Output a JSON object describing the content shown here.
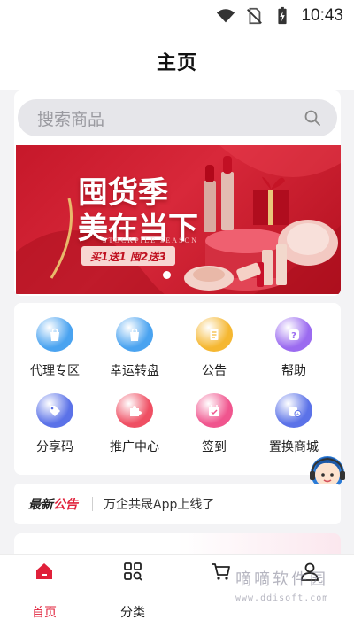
{
  "status_bar": {
    "time": "10:43"
  },
  "header": {
    "title": "主页"
  },
  "search": {
    "placeholder": "搜索商品"
  },
  "banner": {
    "title_line1": "囤货季",
    "title_line2": "美在当下",
    "subtitle": "STOCKPILE SEASON",
    "promo": "买1送1 囤2送3",
    "slide_count": 1,
    "active_slide": 1
  },
  "grid": {
    "items": [
      {
        "label": "代理专区",
        "icon": "shopping-bag-icon",
        "color": "#4aa3f0"
      },
      {
        "label": "幸运转盘",
        "icon": "shopping-bag-icon",
        "color": "#4aa3f0"
      },
      {
        "label": "公告",
        "icon": "document-icon",
        "color": "#f5b731"
      },
      {
        "label": "帮助",
        "icon": "question-icon",
        "color": "#9b6bf0"
      },
      {
        "label": "分享码",
        "icon": "tag-icon",
        "color": "#5b72e8"
      },
      {
        "label": "推广中心",
        "icon": "puzzle-icon",
        "color": "#ef4f63"
      },
      {
        "label": "签到",
        "icon": "calendar-check-icon",
        "color": "#f0558e"
      },
      {
        "label": "置换商城",
        "icon": "coins-icon",
        "color": "#5b72e8"
      }
    ]
  },
  "notice": {
    "label_prefix": "最新",
    "label_accent": "公告",
    "text": "万企共晟App上线了"
  },
  "bottom_nav": {
    "items": [
      {
        "label": "首页",
        "icon": "home-icon",
        "active": true
      },
      {
        "label": "分类",
        "icon": "category-icon",
        "active": false
      },
      {
        "label": "",
        "icon": "cart-icon",
        "active": false
      },
      {
        "label": "",
        "icon": "user-icon",
        "active": false
      }
    ]
  },
  "watermark": {
    "text": "嘀嘀软件园",
    "url": "www.ddisoft.com"
  },
  "colors": {
    "accent": "#e0203a",
    "banner": "#c6182a"
  }
}
